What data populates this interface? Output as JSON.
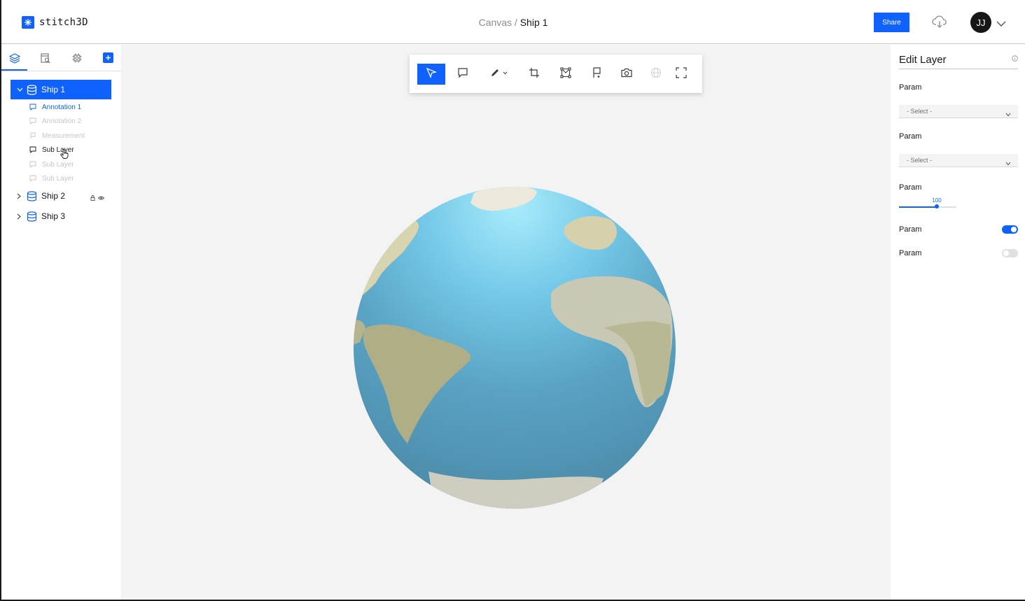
{
  "app": {
    "logo_text": "stitch3D",
    "breadcrumb": {
      "root": "Canvas",
      "separator": " / ",
      "current": "Ship 1"
    },
    "share_label": "Share",
    "avatar_initials": "JJ",
    "accent_color": "#0f62fe"
  },
  "sidebar": {
    "tabs": [
      "layers-icon",
      "search-file-icon",
      "settings-icon"
    ],
    "layers": [
      {
        "label": "Ship 1",
        "expanded": true,
        "selected": true,
        "children": [
          {
            "label": "Annotation 1",
            "icon": "comment-icon",
            "state": "active"
          },
          {
            "label": "Annotation 2",
            "icon": "comment-icon",
            "state": "disabled"
          },
          {
            "label": "Measurement",
            "icon": "measure-icon",
            "state": "disabled"
          },
          {
            "label": "Sub Layer",
            "icon": "comment-icon",
            "state": "normal"
          },
          {
            "label": "Sub Layer",
            "icon": "comment-icon",
            "state": "disabled"
          },
          {
            "label": "Sub Layer",
            "icon": "comment-icon",
            "state": "disabled"
          }
        ]
      },
      {
        "label": "Ship 2",
        "expanded": false,
        "selected": false
      },
      {
        "label": "Ship 3",
        "expanded": false,
        "selected": false
      }
    ]
  },
  "toolbar": {
    "tools": [
      "select-icon",
      "comment-icon",
      "pen-icon",
      "crop-icon",
      "transform-icon",
      "measure-icon",
      "camera-icon",
      "globe-icon",
      "fullscreen-icon"
    ],
    "active_tool": "select-icon"
  },
  "panel": {
    "title": "Edit Layer",
    "params": [
      {
        "label": "Param",
        "type": "select",
        "value": "- Select -"
      },
      {
        "label": "Param",
        "type": "select",
        "value": "- Select -"
      },
      {
        "label": "Param",
        "type": "slider",
        "value": "100",
        "fraction": 0.66
      },
      {
        "label": "Param",
        "type": "toggle",
        "on": true
      },
      {
        "label": "Param",
        "type": "toggle",
        "on": false
      }
    ]
  }
}
